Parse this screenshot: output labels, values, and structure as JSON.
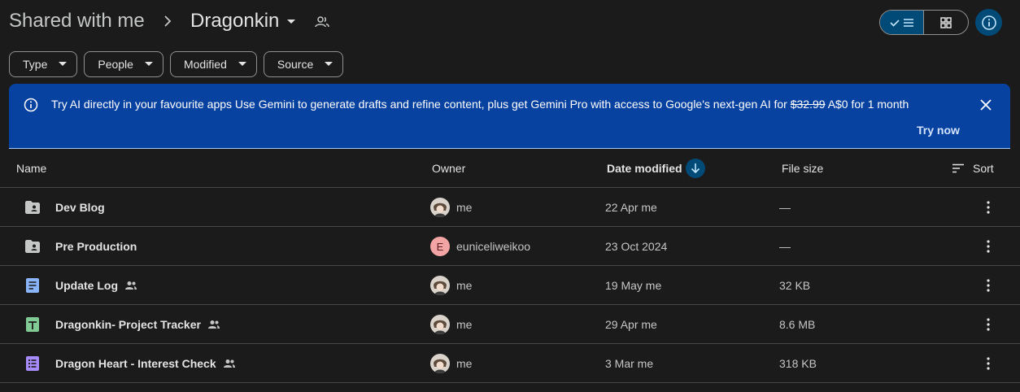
{
  "breadcrumb": {
    "parent": "Shared with me",
    "current": "Dragonkin"
  },
  "filters": [
    "Type",
    "People",
    "Modified",
    "Source"
  ],
  "banner": {
    "title": "Try AI directly in your favourite apps",
    "body": "Use Gemini to generate drafts and refine content, plus get Gemini Pro with access to Google's next-gen AI for",
    "old_price": "$32.99",
    "new_price": "A$0 for 1 month",
    "cta": "Try now"
  },
  "table": {
    "columns": {
      "name": "Name",
      "owner": "Owner",
      "date": "Date modified",
      "size": "File size",
      "sort": "Sort"
    },
    "rows": [
      {
        "name": "Dev Blog",
        "type": "shared-folder",
        "shared": false,
        "owner": "me",
        "avatar": "photo",
        "date": "22 Apr me",
        "size": "—"
      },
      {
        "name": "Pre Production",
        "type": "shared-folder",
        "shared": false,
        "owner": "euniceliweikoo",
        "avatar": "E",
        "date": "23 Oct 2024",
        "size": "—"
      },
      {
        "name": "Update Log",
        "type": "doc",
        "shared": true,
        "owner": "me",
        "avatar": "photo",
        "date": "19 May me",
        "size": "32 KB"
      },
      {
        "name": "Dragonkin- Project Tracker",
        "type": "sheet",
        "shared": true,
        "owner": "me",
        "avatar": "photo",
        "date": "29 Apr me",
        "size": "8.6 MB"
      },
      {
        "name": "Dragon Heart - Interest Check",
        "type": "form",
        "shared": true,
        "owner": "me",
        "avatar": "photo",
        "date": "3 Mar me",
        "size": "318 KB"
      }
    ]
  },
  "colors": {
    "background": "#1b1b1b",
    "banner": "#0842a0",
    "accent": "#004a77",
    "doc": "#8ab4f8",
    "sheet": "#81c995",
    "form": "#a78bfa"
  }
}
